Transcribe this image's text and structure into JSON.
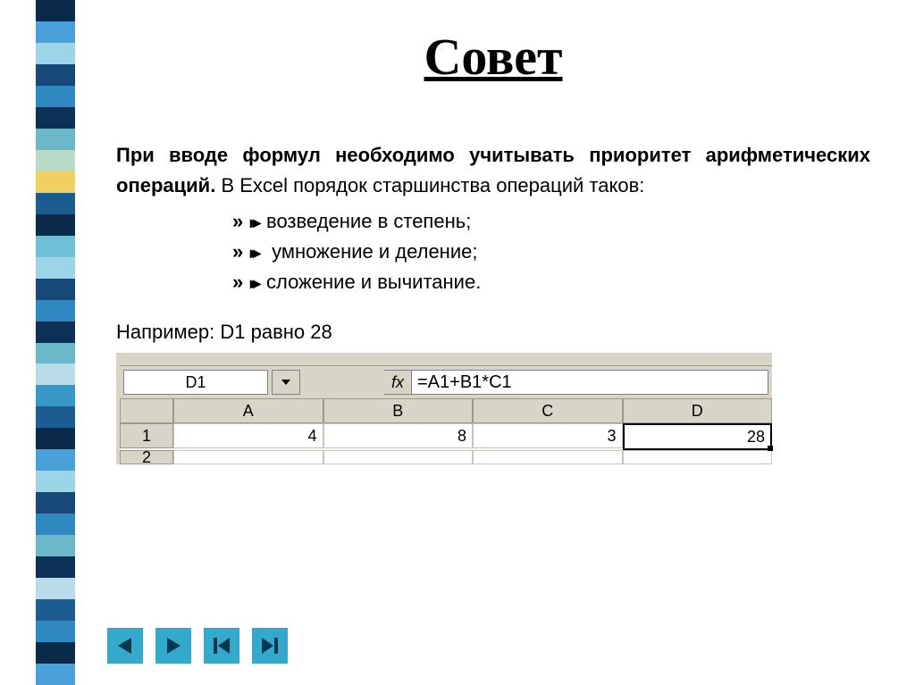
{
  "title": "Совет",
  "paragraph_bold": "При вводе формул необходимо учитывать приоритет арифметических операций.",
  "paragraph_rest": " В Excel порядок старшинства операций таков:",
  "bullets": [
    "возведение в степень;",
    " умножение и деление;",
    "сложение и вычитание."
  ],
  "example": "Например:  D1 равно 28",
  "excel": {
    "namebox": "D1",
    "fx_label": "fx",
    "formula": "=A1+B1*C1",
    "col_headers": [
      "A",
      "B",
      "C",
      "D"
    ],
    "rows": [
      {
        "num": "1",
        "cells": [
          "4",
          "8",
          "3",
          "28"
        ]
      },
      {
        "num": "2",
        "cells": [
          "",
          "",
          "",
          ""
        ]
      }
    ],
    "selected": "D1"
  },
  "deco_colors": [
    "#0a2a4a",
    "#4aa0d8",
    "#9cd4e8",
    "#184878",
    "#3088c0",
    "#0c3058",
    "#6cb8c8",
    "#b8dcc8",
    "#f0d060",
    "#1c5c90",
    "#0a2a4a",
    "#70c0d8",
    "#9cd4e8",
    "#184878",
    "#3088c0",
    "#0c3058",
    "#6cb8c8",
    "#b8dce8",
    "#3898c8",
    "#1c5c90",
    "#0a2a4a",
    "#4aa0d8",
    "#9cd4e8",
    "#184878",
    "#3088c0",
    "#6cb8c8",
    "#0c3058",
    "#b8dce8",
    "#1c5c90",
    "#3088c0",
    "#0a2a4a",
    "#4aa0d8"
  ],
  "nav": {
    "prev": "previous-slide",
    "next": "next-slide",
    "first": "first-slide",
    "last": "last-slide"
  }
}
